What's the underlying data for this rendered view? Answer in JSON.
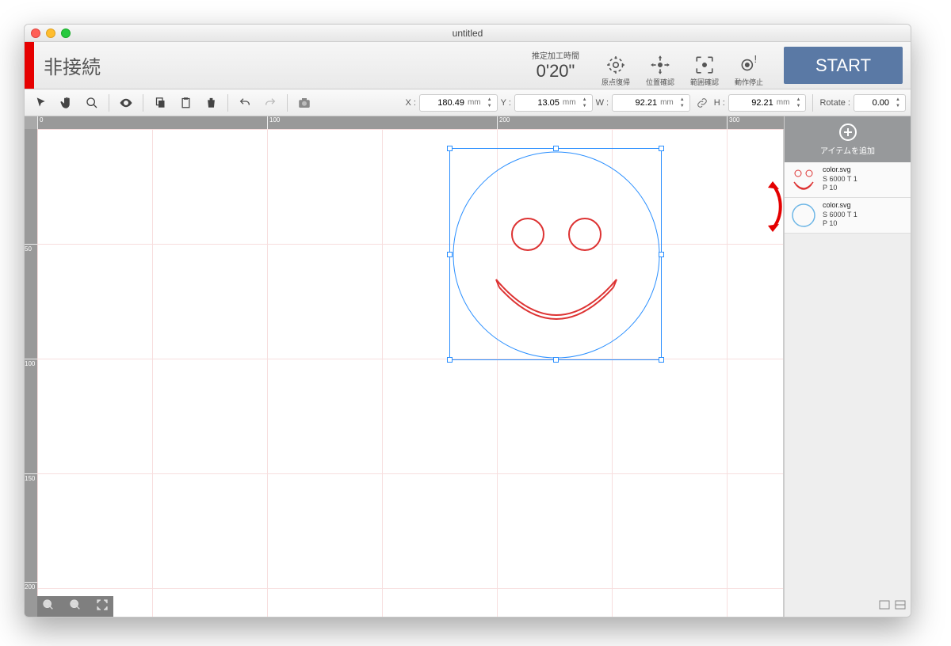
{
  "window": {
    "title": "untitled"
  },
  "header": {
    "status": "非接続",
    "time_label": "推定加工時間",
    "time_value": "0'20\"",
    "actions": {
      "home": "原点復帰",
      "position": "位置確認",
      "range": "範囲確認",
      "stop": "動作停止"
    },
    "start": "START"
  },
  "coords": {
    "x_label": "X :",
    "x_value": "180.49",
    "x_unit": "mm",
    "y_label": "Y :",
    "y_value": "13.05",
    "y_unit": "mm",
    "w_label": "W :",
    "w_value": "92.21",
    "w_unit": "mm",
    "h_label": "H :",
    "h_value": "92.21",
    "h_unit": "mm",
    "rotate_label": "Rotate :",
    "rotate_value": "0.00"
  },
  "ruler": {
    "h0": "0",
    "h100": "100",
    "h200": "200",
    "h300": "300",
    "v50": "50",
    "v100": "100",
    "v150": "150",
    "v200": "200"
  },
  "sidebar": {
    "add_label": "アイテムを追加",
    "items": [
      {
        "name": "color.svg",
        "line1": "S 6000   T 1",
        "line2": "P 10"
      },
      {
        "name": "color.svg",
        "line1": "S 6000   T 1",
        "line2": "P 10"
      }
    ]
  }
}
